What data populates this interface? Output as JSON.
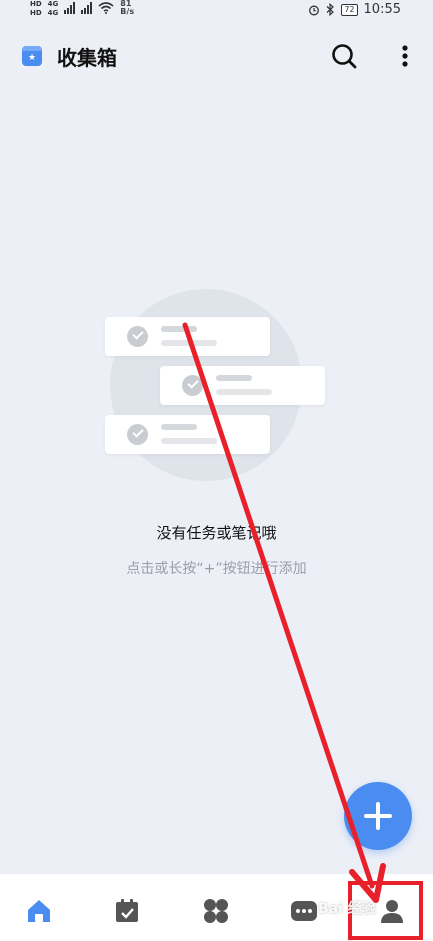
{
  "status_bar": {
    "net_top": "HD",
    "net_bottom": "HD",
    "net_type_1": "4G",
    "net_type_2": "4G",
    "speed_value": "81",
    "speed_unit": "B/s",
    "battery": "72",
    "time": "10:55"
  },
  "header": {
    "title": "收集箱",
    "app_icon_glyph": "★"
  },
  "empty_state": {
    "title": "没有任务或笔记哦",
    "hint": "点击或长按“+”按钮进行添加"
  },
  "watermark": {
    "text": "Bai 经验"
  },
  "colors": {
    "accent": "#4a8cf0",
    "background": "#eceff6",
    "active_tab": "#4a8cf0",
    "inactive_tab": "#555555",
    "annotation": "#e8202a"
  },
  "bottom_nav": {
    "items": [
      {
        "icon": "home-icon",
        "active": true
      },
      {
        "icon": "calendar-check-icon",
        "active": false
      },
      {
        "icon": "four-squares-icon",
        "active": false
      },
      {
        "icon": "more-dots-icon",
        "active": false
      },
      {
        "icon": "profile-icon",
        "active": false
      }
    ]
  }
}
